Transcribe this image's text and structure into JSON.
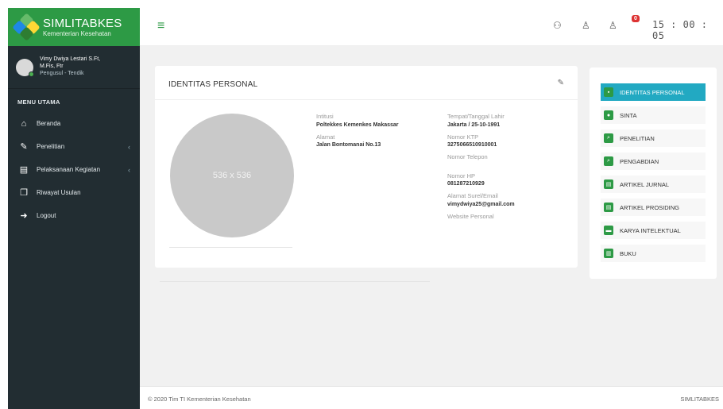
{
  "brand": {
    "title": "SIMLITABKES",
    "subtitle": "Kementerian Kesehatan",
    "colors": [
      "#2e7d32",
      "#66bb6a",
      "#1e88e5",
      "#fdd835"
    ]
  },
  "user": {
    "name_line1": "Vimy Dwiya Lestari S.Ft,",
    "name_line2": "M.Fis, Ftr",
    "role": "Pengusul - Tendik"
  },
  "sidebar": {
    "header": "MENU UTAMA",
    "items": [
      {
        "label": "Beranda",
        "icon": "home-icon",
        "glyph": "⌂",
        "has_submenu": false
      },
      {
        "label": "Penelitian",
        "icon": "edit-icon",
        "glyph": "✎",
        "has_submenu": true
      },
      {
        "label": "Pelaksanaan Kegiatan",
        "icon": "clipboard-icon",
        "glyph": "▤",
        "has_submenu": true
      },
      {
        "label": "Riwayat Usulan",
        "icon": "files-icon",
        "glyph": "❐",
        "has_submenu": false
      },
      {
        "label": "Logout",
        "icon": "logout-icon",
        "glyph": "➜",
        "has_submenu": false
      }
    ],
    "chevron": "‹"
  },
  "topbar": {
    "hamburger": "≡",
    "icons": [
      {
        "name": "users-icon",
        "glyph": "⚇"
      },
      {
        "name": "user-icon",
        "glyph": "♙"
      },
      {
        "name": "user-notify-icon",
        "glyph": "♙"
      }
    ],
    "badge": "0",
    "clock": "15 : 00 : 05"
  },
  "profile_card": {
    "title": "IDENTITAS PERSONAL",
    "edit_icon": "✎",
    "photo_placeholder": "536 x 536",
    "fields_left": [
      {
        "label": "Intitusi",
        "value": "Poltekkes Kemenkes Makassar"
      },
      {
        "label": "Alamat",
        "value": "Jalan Bontomanai No.13"
      }
    ],
    "fields_right": [
      {
        "label": "Tempat/Tanggal Lahir",
        "value": "Jakarta / 25-10-1991"
      },
      {
        "label": "Nomor KTP",
        "value": "3275066510910001"
      },
      {
        "label": "Nomor Telepon",
        "value": ""
      },
      {
        "label": "Nomor HP",
        "value": "081287210929"
      },
      {
        "label": "Alamat Surel/Email",
        "value": "vimydwiya25@gmail.com"
      },
      {
        "label": "Website Personal",
        "value": ""
      }
    ]
  },
  "side_menu": {
    "items": [
      {
        "label": "IDENTITAS PERSONAL",
        "glyph": "▪",
        "active": true
      },
      {
        "label": "SINTA",
        "glyph": "●",
        "active": false
      },
      {
        "label": "PENELITIAN",
        "glyph": "⌕",
        "active": false
      },
      {
        "label": "PENGABDIAN",
        "glyph": "⌕",
        "active": false
      },
      {
        "label": "ARTIKEL JURNAL",
        "glyph": "▤",
        "active": false
      },
      {
        "label": "ARTIKEL PROSIDING",
        "glyph": "▤",
        "active": false
      },
      {
        "label": "KARYA INTELEKTUAL",
        "glyph": "▬",
        "active": false
      },
      {
        "label": "BUKU",
        "glyph": "▥",
        "active": false
      }
    ]
  },
  "footer": {
    "copyright": "© 2020 Tim TI Kementerian Kesehatan",
    "brand": "SIMLITABKES"
  }
}
